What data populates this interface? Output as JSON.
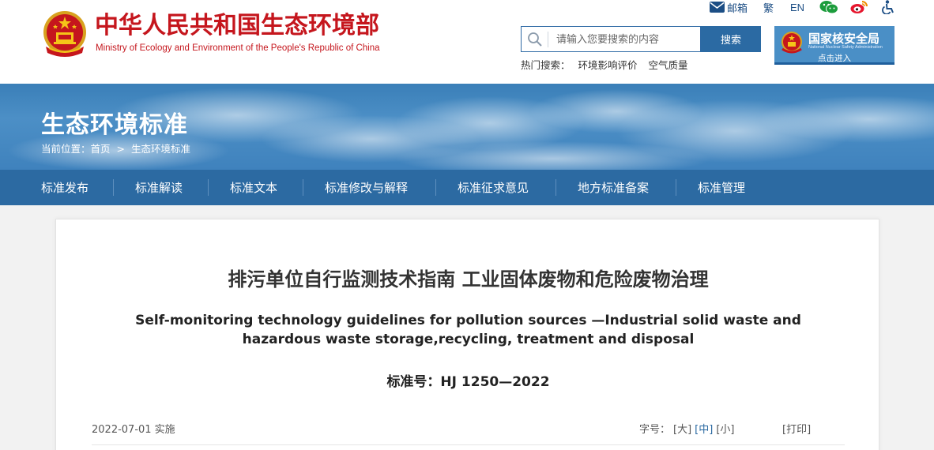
{
  "header": {
    "site_name_cn": "中华人民共和国生态环境部",
    "site_name_en": "Ministry of Ecology and Environment of the People's Republic of China",
    "top_links": {
      "mail": "邮箱",
      "traditional": "繁",
      "english": "EN"
    },
    "search": {
      "placeholder": "请输入您要搜索的内容",
      "button": "搜索"
    },
    "hot_search": {
      "label": "热门搜索：",
      "items": [
        "环境影响评价",
        "空气质量"
      ]
    },
    "nnsa": {
      "name": "国家核安全局",
      "name_en": "National Nuclear Safety Administration",
      "enter": "点击进入"
    }
  },
  "banner": {
    "title": "生态环境标准",
    "breadcrumb": {
      "prefix": "当前位置：",
      "home": "首页",
      "separator": ">",
      "current": "生态环境标准"
    }
  },
  "nav": {
    "items": [
      "标准发布",
      "标准解读",
      "标准文本",
      "标准修改与解释",
      "标准征求意见",
      "地方标准备案",
      "标准管理"
    ]
  },
  "article": {
    "title_cn": "排污单位自行监测技术指南 工业固体废物和危险废物治理",
    "title_en": "Self-monitoring technology guidelines for pollution sources —Industrial solid waste and hazardous waste storage,recycling, treatment and disposal",
    "standard_no": "标准号：HJ 1250—2022",
    "date": "2022-07-01 实施",
    "font_size_label": "字号：",
    "font_sizes": [
      "[大]",
      "[中]",
      "[小]"
    ],
    "active_font_size": "[中]",
    "print": "[打印]"
  },
  "colors": {
    "brand_red": "#c5161d",
    "nav_blue": "#2c6aa2",
    "link_blue": "#1c4e85"
  }
}
